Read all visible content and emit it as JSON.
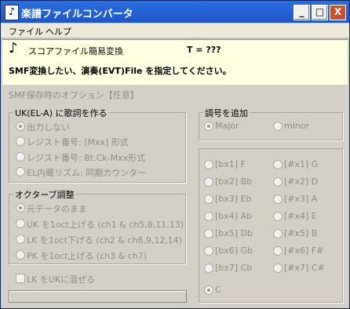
{
  "window": {
    "title": "楽譜ファイルコンバータ",
    "app_icon": "score-icon"
  },
  "titlebar_buttons": {
    "minimize": "_",
    "maximize": "□",
    "close": "X"
  },
  "menu": [
    "ファイル",
    "ヘルプ"
  ],
  "banner": {
    "icon": "♪",
    "mode": "スコアファイル簡易変換",
    "tempo": "T = ???",
    "instruction": "SMF変換したい、演奏(EVT)File を指定してください。"
  },
  "options": {
    "title": "SMF保存時のオプション【任意】",
    "lyrics": {
      "title": "UK(EL-A) に歌詞を作る",
      "items": [
        "出力しない",
        "レジスト番号:  [Mxx] 形式",
        "レジスト番号:  Bt.Ck-Mxx形式",
        "EL内蔵リズム:  同期カウンター"
      ],
      "selected": 0
    },
    "octave": {
      "title": "オクターブ調整",
      "items": [
        "元データのまま",
        "UK を1oct上げる (ch1 & ch5,8,11,13)",
        "LK を1oct下げる (ch2 & ch6,9,12,14)",
        "PK を1oct上げる (ch3 & ch7)"
      ],
      "selected": 0
    },
    "mix": {
      "label": "LK をUKに混ぜる",
      "checked": false
    },
    "key": {
      "title": "調号を追加",
      "mode_items": [
        "Major",
        "minor"
      ],
      "mode_selected": 0,
      "left_keys": [
        "[bx1] F",
        "[bx2] Bb",
        "[bx3] Eb",
        "[bx4] Ab",
        "[bx5] Db",
        "[bx6] Gb",
        "[bx7] Cb",
        "C"
      ],
      "right_keys": [
        "[#x1] G",
        "[#x2] D",
        "[#x3] A",
        "[#x4] E",
        "[#x5] B",
        "[#x6] F#",
        "[#x7] C#"
      ],
      "selected": "C"
    }
  }
}
